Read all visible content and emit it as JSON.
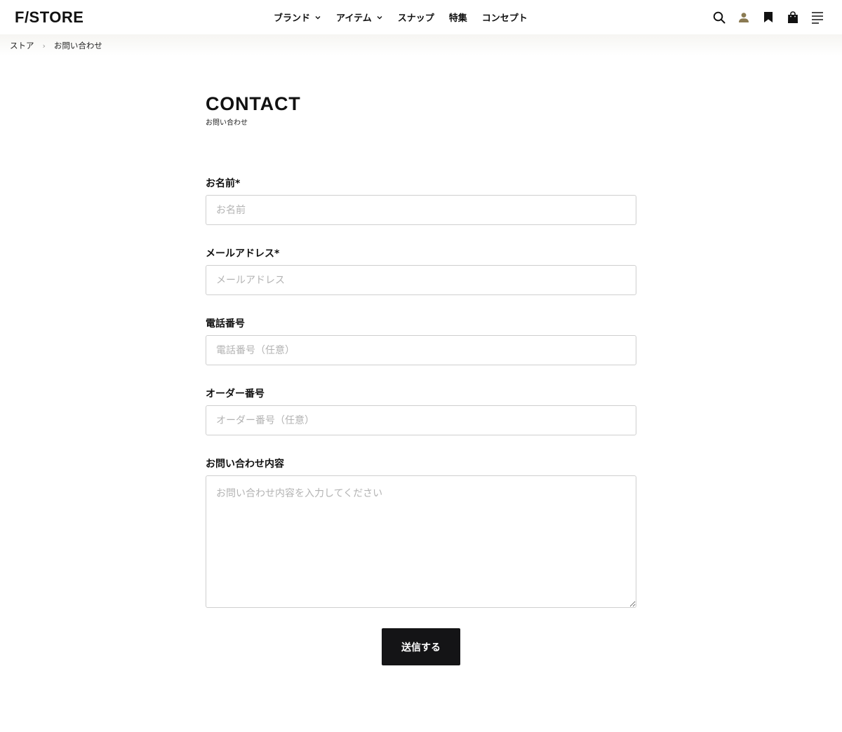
{
  "header": {
    "logo": "F/STORE",
    "nav": [
      {
        "label": "ブランド",
        "has_dropdown": true
      },
      {
        "label": "アイテム",
        "has_dropdown": true
      },
      {
        "label": "スナップ",
        "has_dropdown": false
      },
      {
        "label": "特集",
        "has_dropdown": false
      },
      {
        "label": "コンセプト",
        "has_dropdown": false
      }
    ],
    "icons": [
      "search-icon",
      "user-icon",
      "bookmark-icon",
      "shopping-bag-icon",
      "menu-icon"
    ],
    "user_icon_color": "#8a7a52"
  },
  "breadcrumb": {
    "items": [
      "ストア",
      "お問い合わせ"
    ]
  },
  "page": {
    "title": "CONTACT",
    "subtitle": "お問い合わせ"
  },
  "form": {
    "name": {
      "label": "お名前*",
      "placeholder": "お名前"
    },
    "email": {
      "label": "メールアドレス*",
      "placeholder": "メールアドレス"
    },
    "phone": {
      "label": "電話番号",
      "placeholder": "電話番号（任意）"
    },
    "order": {
      "label": "オーダー番号",
      "placeholder": "オーダー番号（任意）"
    },
    "message": {
      "label": "お問い合わせ内容",
      "placeholder": "お問い合わせ内容を入力してください"
    },
    "submit_label": "送信する"
  },
  "colors": {
    "button_bg": "#141416",
    "input_border": "#cfcfcf",
    "placeholder": "#b3b3b3"
  }
}
